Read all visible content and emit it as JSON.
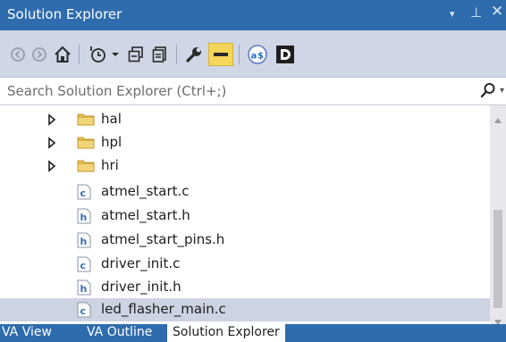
{
  "window": {
    "title": "Solution Explorer",
    "dropdown_glyph": "▾",
    "pin_glyph": "⊥",
    "close_glyph": "✕"
  },
  "toolbar": {
    "icons": [
      "back-icon",
      "forward-icon",
      "home-icon",
      "pending-changes-filter-icon",
      "collapse-all-icon",
      "show-all-files-icon",
      "properties-wrench-icon",
      "preview-selected-icon",
      "visual-assist-icon",
      "d-logo-icon"
    ]
  },
  "search": {
    "placeholder": "Search Solution Explorer (Ctrl+;)"
  },
  "tree": {
    "items": [
      {
        "label": "hal",
        "type": "folder",
        "expandable": true,
        "selected": false
      },
      {
        "label": "hpl",
        "type": "folder",
        "expandable": true,
        "selected": false
      },
      {
        "label": "hri",
        "type": "folder",
        "expandable": true,
        "selected": false
      },
      {
        "label": "atmel_start.c",
        "type": "c-file",
        "badge": "c",
        "expandable": false,
        "selected": false
      },
      {
        "label": "atmel_start.h",
        "type": "h-file",
        "badge": "h",
        "expandable": false,
        "selected": false
      },
      {
        "label": "atmel_start_pins.h",
        "type": "h-file",
        "badge": "h",
        "expandable": false,
        "selected": false
      },
      {
        "label": "driver_init.c",
        "type": "c-file",
        "badge": "c",
        "expandable": false,
        "selected": false
      },
      {
        "label": "driver_init.h",
        "type": "h-file",
        "badge": "h",
        "expandable": false,
        "selected": false
      },
      {
        "label": "led_flasher_main.c",
        "type": "c-file",
        "badge": "c",
        "expandable": false,
        "selected": true
      }
    ]
  },
  "tabs": [
    {
      "label": "VA View",
      "active": false
    },
    {
      "label": "VA Outline",
      "active": false
    },
    {
      "label": "Solution Explorer",
      "active": true
    }
  ],
  "colors": {
    "accent": "#2e6cae",
    "toolbar_bg": "#cfd6e5",
    "selection": "#ccd3e2",
    "folder": "#e8c35a",
    "file_badge": "#3a6fb5"
  }
}
